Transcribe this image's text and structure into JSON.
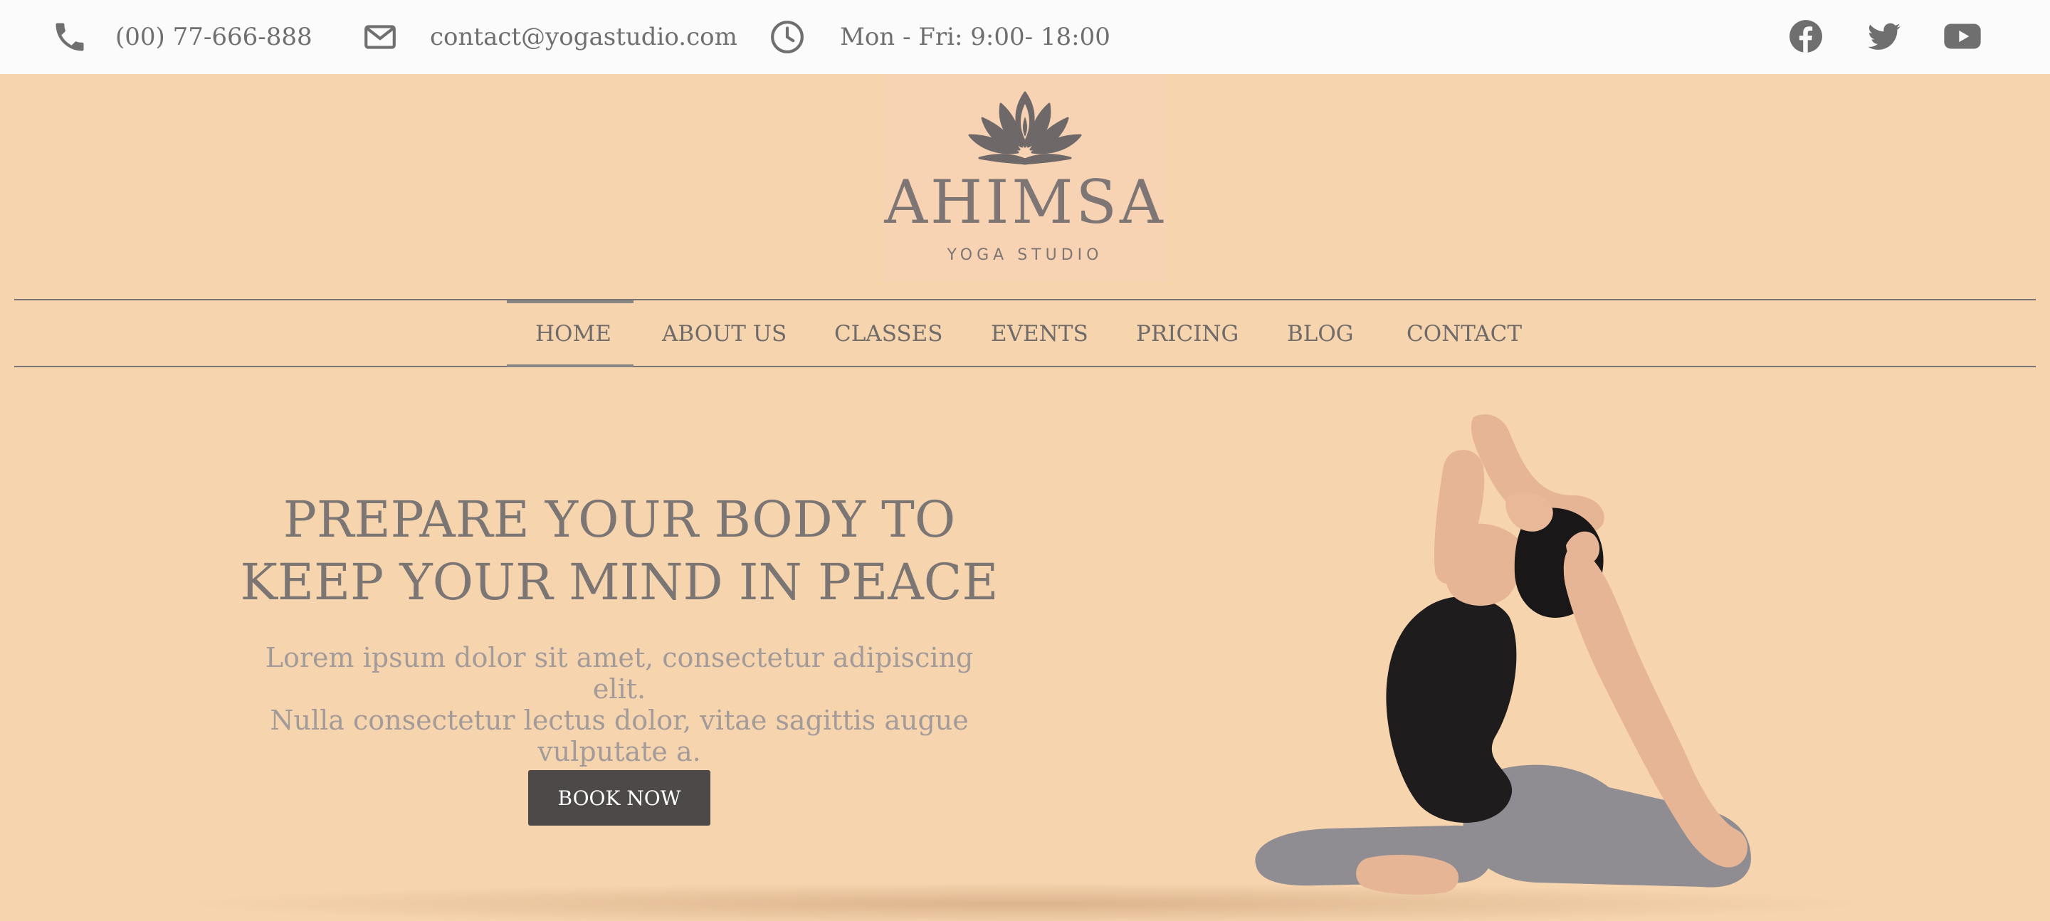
{
  "topbar": {
    "phone": "(00) 77-666-888",
    "email": "contact@yogastudio.com",
    "hours": "Mon - Fri: 9:00- 18:00",
    "icons": [
      "phone-icon",
      "envelope-icon",
      "clock-icon"
    ],
    "social": [
      "facebook-icon",
      "twitter-icon",
      "youtube-icon"
    ]
  },
  "logo": {
    "name": "AHIMSA",
    "subtitle": "YOGA STUDIO",
    "icon": "lotus-icon"
  },
  "nav": {
    "items": [
      {
        "label": "HOME",
        "active": true
      },
      {
        "label": "ABOUT US",
        "active": false
      },
      {
        "label": "CLASSES",
        "active": false
      },
      {
        "label": "EVENTS",
        "active": false
      },
      {
        "label": "PRICING",
        "active": false
      },
      {
        "label": "BLOG",
        "active": false
      },
      {
        "label": "CONTACT",
        "active": false
      }
    ]
  },
  "hero": {
    "title_line1": "PREPARE YOUR BODY TO",
    "title_line2": "KEEP YOUR MIND IN PEACE",
    "subtitle_line1": "Lorem ipsum dolor sit amet, consectetur adipiscing elit.",
    "subtitle_line2": "Nulla consectetur lectus dolor, vitae sagittis augue",
    "subtitle_line3": "vulputate a.",
    "button_label": "BOOK NOW"
  },
  "colors": {
    "background": "#f6d4ae",
    "topbar": "#fbfbfb",
    "text": "#7b7574",
    "button": "#4d4948"
  }
}
